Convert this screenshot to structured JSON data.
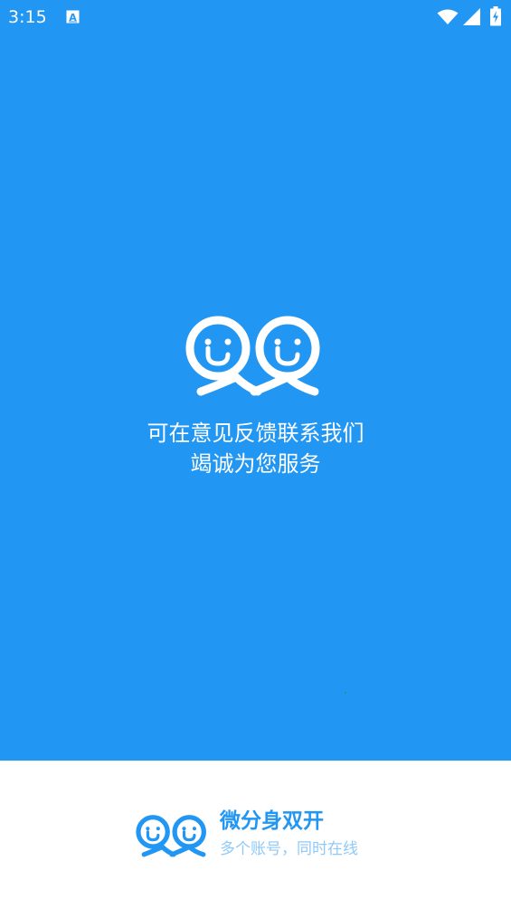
{
  "status_bar": {
    "time": "3:15",
    "notification_icon": "text-a-icon",
    "icons": [
      "wifi-icon",
      "cellular-signal-icon",
      "battery-charging-icon"
    ]
  },
  "splash": {
    "logo": "smiley-duo-logo",
    "line1": "可在意见反馈联系我们",
    "line2": "竭诚为您服务"
  },
  "footer": {
    "logo": "smiley-duo-logo",
    "app_name": "微分身双开",
    "tagline": "多个账号，同时在线"
  },
  "colors": {
    "primary": "#2196f3",
    "tagline": "#8fc9f8",
    "background": "#ffffff"
  }
}
